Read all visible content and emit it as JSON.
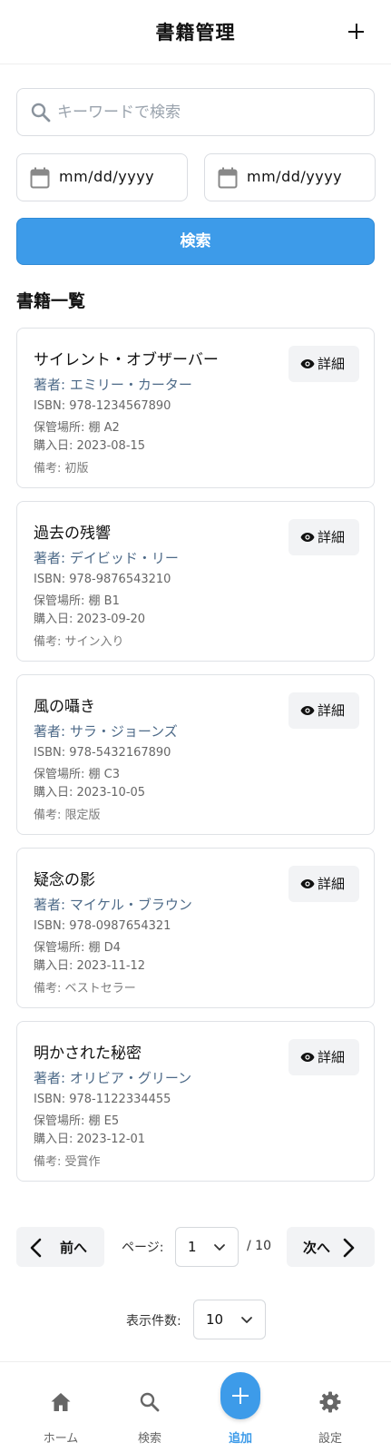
{
  "header": {
    "title": "書籍管理",
    "add_icon": "plus-icon"
  },
  "search": {
    "placeholder": "キーワードで検索",
    "date_from": "mm/dd/yyyy",
    "date_to": "mm/dd/yyyy",
    "button_label": "検索"
  },
  "list": {
    "title": "書籍一覧",
    "detail_label": "詳細",
    "books": [
      {
        "title": "サイレント・オブザーバー",
        "author": "著者: エミリー・カーター",
        "isbn": "ISBN: 978-1234567890",
        "location": "保管場所: 棚 A2",
        "purchase": "購入日: 2023-08-15",
        "notes": "備考: 初版"
      },
      {
        "title": "過去の残響",
        "author": "著者: デイビッド・リー",
        "isbn": "ISBN: 978-9876543210",
        "location": "保管場所: 棚 B1",
        "purchase": "購入日: 2023-09-20",
        "notes": "備考: サイン入り"
      },
      {
        "title": "風の囁き",
        "author": "著者: サラ・ジョーンズ",
        "isbn": "ISBN: 978-5432167890",
        "location": "保管場所: 棚 C3",
        "purchase": "購入日: 2023-10-05",
        "notes": "備考: 限定版"
      },
      {
        "title": "疑念の影",
        "author": "著者: マイケル・ブラウン",
        "isbn": "ISBN: 978-0987654321",
        "location": "保管場所: 棚 D4",
        "purchase": "購入日: 2023-11-12",
        "notes": "備考: ベストセラー"
      },
      {
        "title": "明かされた秘密",
        "author": "著者: オリビア・グリーン",
        "isbn": "ISBN: 978-1122334455",
        "location": "保管場所: 棚 E5",
        "purchase": "購入日: 2023-12-01",
        "notes": "備考: 受賞作"
      }
    ]
  },
  "pagination": {
    "prev_label": "前へ",
    "next_label": "次へ",
    "page_label": "ページ:",
    "current_page": "1",
    "total_pages": "/ 10",
    "per_page_label": "表示件数:",
    "per_page": "10"
  },
  "bottom_nav": {
    "home": "ホーム",
    "search": "検索",
    "add": "追加",
    "settings": "設定"
  },
  "colors": {
    "accent": "#3d9be9",
    "author_text": "#4d6a88"
  }
}
